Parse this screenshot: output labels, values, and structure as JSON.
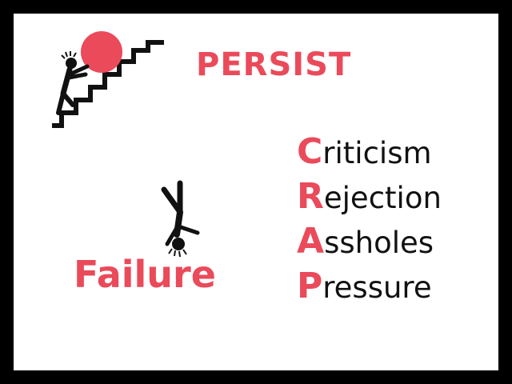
{
  "persist_label": "PERSIST",
  "failure_label": "Failure",
  "acronym": [
    {
      "letter": "C",
      "rest": "riticism"
    },
    {
      "letter": "R",
      "rest": "ejection"
    },
    {
      "letter": "A",
      "rest": "ssholes"
    },
    {
      "letter": "P",
      "rest": "ressure"
    }
  ],
  "colors": {
    "accent": "#ea4a5a",
    "text": "#111111",
    "background": "#ffffff",
    "frame": "#000000"
  },
  "icons": {
    "climber": "stick-figure-pushing-ball-up-stairs-icon",
    "fallen": "upside-down-stick-figure-icon"
  }
}
